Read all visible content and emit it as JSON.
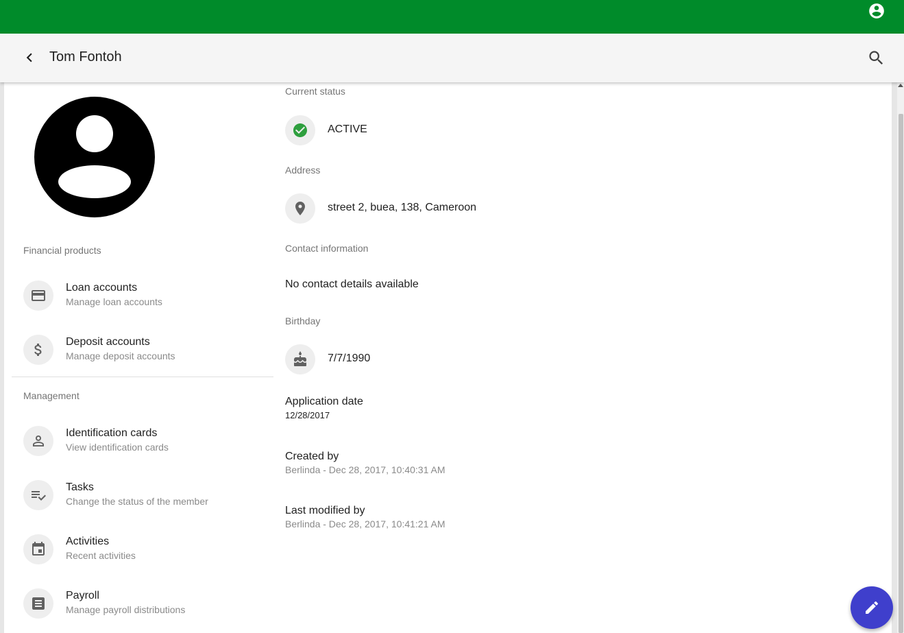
{
  "header": {
    "title": "Tom Fontoh"
  },
  "icons": {
    "account": "account-circle-icon",
    "back": "chevron-left-icon",
    "search": "search-icon",
    "avatar": "account-circle-icon",
    "status": "check-circle-icon",
    "address": "place-icon",
    "birthday": "cake-icon",
    "fab": "pencil-icon"
  },
  "colors": {
    "topbar": "#008b2a",
    "status": "#2e9f3e",
    "fab": "#3f3fcc"
  },
  "sidebar": {
    "financial_label": "Financial products",
    "financial_items": [
      {
        "label": "Loan accounts",
        "sub": "Manage loan accounts",
        "icon": "credit-card-icon"
      },
      {
        "label": "Deposit accounts",
        "sub": "Manage deposit accounts",
        "icon": "dollar-icon"
      }
    ],
    "management_label": "Management",
    "management_items": [
      {
        "label": "Identification cards",
        "sub": "View identification cards",
        "icon": "person-icon"
      },
      {
        "label": "Tasks",
        "sub": "Change the status of the member",
        "icon": "playlist-check-icon"
      },
      {
        "label": "Activities",
        "sub": "Recent activities",
        "icon": "calendar-icon"
      },
      {
        "label": "Payroll",
        "sub": "Manage payroll distributions",
        "icon": "receipt-icon"
      }
    ]
  },
  "details": {
    "status_label": "Current status",
    "status_value": "ACTIVE",
    "address_label": "Address",
    "address_value": "street 2, buea, 138, Cameroon",
    "contact_label": "Contact information",
    "contact_value": "No contact details available",
    "birthday_label": "Birthday",
    "birthday_value": "7/7/1990",
    "application_label": "Application date",
    "application_value": "12/28/2017",
    "created_label": "Created by",
    "created_value": "Berlinda - Dec 28, 2017, 10:40:31 AM",
    "modified_label": "Last modified by",
    "modified_value": "Berlinda - Dec 28, 2017, 10:41:21 AM"
  }
}
